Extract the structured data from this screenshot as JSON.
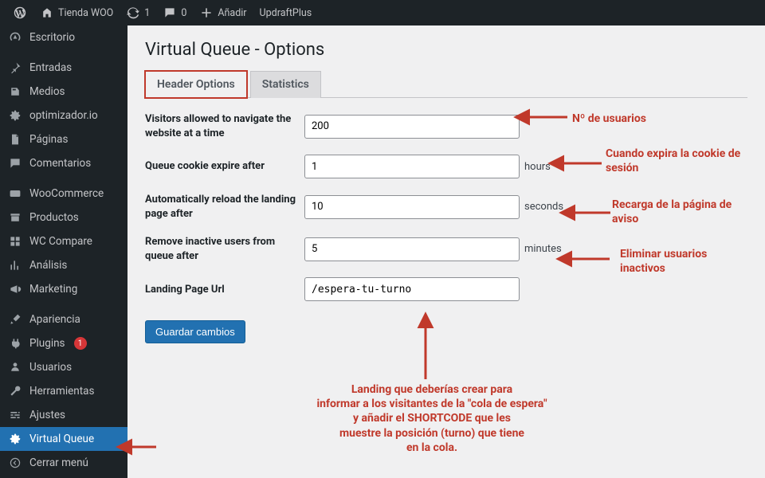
{
  "adminbar": {
    "site_name": "Tienda WOO",
    "updates": "1",
    "comments": "0",
    "add": "Añadir",
    "updraft": "UpdraftPlus"
  },
  "sidebar": {
    "items": [
      {
        "label": "Escritorio"
      },
      {
        "label": "Entradas"
      },
      {
        "label": "Medios"
      },
      {
        "label": "optimizador.io"
      },
      {
        "label": "Páginas"
      },
      {
        "label": "Comentarios"
      },
      {
        "label": "WooCommerce"
      },
      {
        "label": "Productos"
      },
      {
        "label": "WC Compare"
      },
      {
        "label": "Análisis"
      },
      {
        "label": "Marketing"
      },
      {
        "label": "Apariencia"
      },
      {
        "label": "Plugins",
        "badge": "1"
      },
      {
        "label": "Usuarios"
      },
      {
        "label": "Herramientas"
      },
      {
        "label": "Ajustes"
      },
      {
        "label": "Virtual Queue"
      },
      {
        "label": "Cerrar menú"
      }
    ]
  },
  "page": {
    "title": "Virtual Queue - Options"
  },
  "tabs": {
    "header_options": "Header Options",
    "statistics": "Statistics"
  },
  "form": {
    "visitors": {
      "label": "Visitors allowed to navigate the website at a time",
      "value": "200"
    },
    "cookie": {
      "label": "Queue cookie expire after",
      "value": "1",
      "unit": "hours"
    },
    "reload": {
      "label": "Automatically reload the landing page after",
      "value": "10",
      "unit": "seconds"
    },
    "inactive": {
      "label": "Remove inactive users from queue after",
      "value": "5",
      "unit": "minutes"
    },
    "landing": {
      "label": "Landing Page Url",
      "value": "/espera-tu-turno"
    }
  },
  "buttons": {
    "save": "Guardar cambios"
  },
  "annotations": {
    "a1": "Nº de usuarios",
    "a2": "Cuando expira la cookie de sesión",
    "a3": "Recarga de la página de aviso",
    "a4": "Eliminar usuarios inactivos",
    "a5": "Landing que deberías crear para\ninformar a los visitantes de la \"cola de espera\"\ny añadir el SHORTCODE que les\nmuestre la posición (turno) que tiene\nen la cola."
  }
}
